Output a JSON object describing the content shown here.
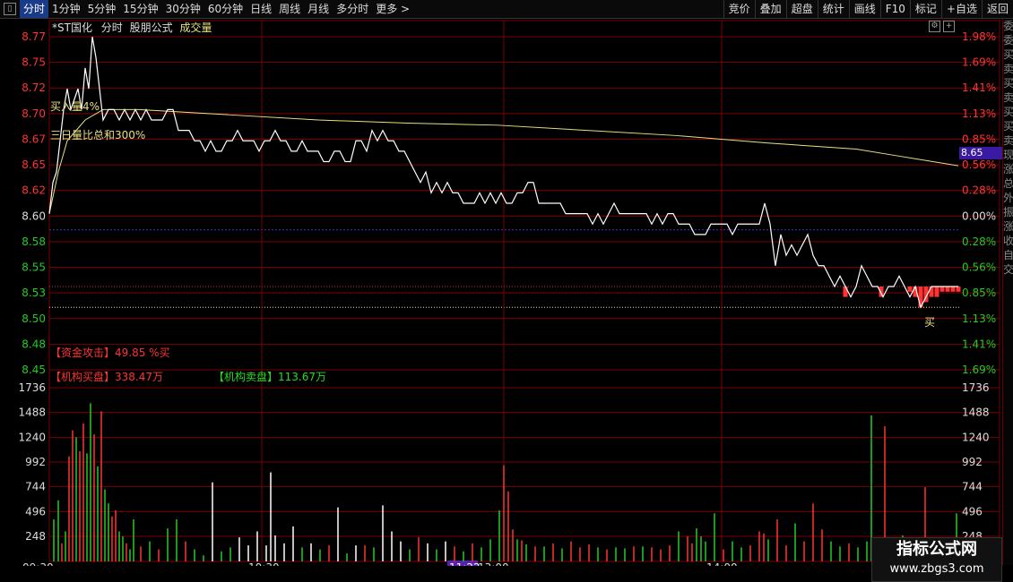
{
  "toolbar": {
    "left_items": [
      "分时",
      "1分钟",
      "5分钟",
      "15分钟",
      "30分钟",
      "60分钟",
      "日线",
      "周线",
      "月线",
      "多分时",
      "更多 >"
    ],
    "right_items": [
      "竞价",
      "叠加",
      "超盘",
      "统计",
      "画线",
      "F10",
      "标记",
      "+自选",
      "返回"
    ]
  },
  "title": {
    "stock": "*ST国化",
    "mode": "分时",
    "formula": "股朋公式",
    "indicator": "成交量"
  },
  "annotations": {
    "buy_vol": "买入量4%",
    "three_day": "三日量比总和300%",
    "fund_attack": "【资金攻击】49.85 %买",
    "inst_buy": "【机构买盘】338.47万",
    "inst_sell": "【机构卖盘】113.67万",
    "buy_mark": "买",
    "current_price_tag": "8.65"
  },
  "watermark": {
    "title": "指标公式网",
    "url": "www.zbgs3.com"
  },
  "right_col_text": [
    "委",
    "委",
    "买",
    "卖",
    "买",
    "卖",
    "买",
    "买",
    "卖",
    "现",
    "涨",
    "总",
    "外",
    "振",
    "涨",
    "收",
    "自",
    "交"
  ],
  "colors": {
    "up": "#ff3333",
    "down": "#22cc22",
    "avg": "#e8e080",
    "grid": "#7a0000",
    "price": "#ffffff",
    "title_accent": "#e8e080"
  },
  "chart_data": {
    "type": "line",
    "price_axis_left": [
      "8.77",
      "8.75",
      "8.72",
      "8.70",
      "8.67",
      "8.65",
      "8.62",
      "8.60",
      "8.58",
      "8.55",
      "8.53",
      "8.50",
      "8.48",
      "8.45"
    ],
    "price_axis_right": [
      "1.98%",
      "1.69%",
      "1.41%",
      "1.13%",
      "0.85%",
      "0.56%",
      "0.28%",
      "0.00%",
      "0.28%",
      "0.56%",
      "0.85%",
      "1.13%",
      "1.41%",
      "1.69%"
    ],
    "vol_axis": [
      "1736",
      "1488",
      "1240",
      "992",
      "744",
      "496",
      "248"
    ],
    "x_ticks": [
      "09:30",
      "10:30",
      "11:22",
      "13:00",
      "14:00"
    ],
    "ylim_price": [
      8.45,
      8.77
    ],
    "prev_close": 8.6,
    "price_points": [
      [
        0,
        8.6
      ],
      [
        4,
        8.63
      ],
      [
        8,
        8.64
      ],
      [
        12,
        8.67
      ],
      [
        16,
        8.7
      ],
      [
        20,
        8.72
      ],
      [
        24,
        8.7
      ],
      [
        28,
        8.71
      ],
      [
        32,
        8.72
      ],
      [
        36,
        8.7
      ],
      [
        40,
        8.74
      ],
      [
        44,
        8.72
      ],
      [
        48,
        8.77
      ],
      [
        52,
        8.75
      ],
      [
        56,
        8.72
      ],
      [
        60,
        8.69
      ],
      [
        66,
        8.7
      ],
      [
        72,
        8.7
      ],
      [
        78,
        8.69
      ],
      [
        84,
        8.7
      ],
      [
        90,
        8.69
      ],
      [
        96,
        8.7
      ],
      [
        102,
        8.69
      ],
      [
        108,
        8.7
      ],
      [
        114,
        8.69
      ],
      [
        120,
        8.69
      ],
      [
        126,
        8.69
      ],
      [
        132,
        8.7
      ],
      [
        138,
        8.7
      ],
      [
        144,
        8.68
      ],
      [
        150,
        8.68
      ],
      [
        156,
        8.68
      ],
      [
        162,
        8.67
      ],
      [
        168,
        8.67
      ],
      [
        174,
        8.66
      ],
      [
        180,
        8.67
      ],
      [
        186,
        8.66
      ],
      [
        192,
        8.66
      ],
      [
        198,
        8.67
      ],
      [
        204,
        8.67
      ],
      [
        210,
        8.68
      ],
      [
        216,
        8.67
      ],
      [
        222,
        8.67
      ],
      [
        228,
        8.67
      ],
      [
        234,
        8.66
      ],
      [
        240,
        8.67
      ],
      [
        246,
        8.67
      ],
      [
        252,
        8.68
      ],
      [
        258,
        8.67
      ],
      [
        264,
        8.67
      ],
      [
        270,
        8.66
      ],
      [
        276,
        8.66
      ],
      [
        282,
        8.67
      ],
      [
        288,
        8.66
      ],
      [
        294,
        8.66
      ],
      [
        300,
        8.66
      ],
      [
        306,
        8.65
      ],
      [
        312,
        8.65
      ],
      [
        318,
        8.66
      ],
      [
        324,
        8.66
      ],
      [
        330,
        8.65
      ],
      [
        336,
        8.65
      ],
      [
        342,
        8.67
      ],
      [
        348,
        8.67
      ],
      [
        354,
        8.66
      ],
      [
        360,
        8.68
      ],
      [
        366,
        8.67
      ],
      [
        372,
        8.68
      ],
      [
        378,
        8.67
      ],
      [
        384,
        8.67
      ],
      [
        390,
        8.66
      ],
      [
        396,
        8.66
      ],
      [
        402,
        8.65
      ],
      [
        408,
        8.64
      ],
      [
        414,
        8.63
      ],
      [
        420,
        8.64
      ],
      [
        426,
        8.62
      ],
      [
        432,
        8.63
      ],
      [
        438,
        8.62
      ],
      [
        444,
        8.63
      ],
      [
        450,
        8.62
      ],
      [
        456,
        8.62
      ],
      [
        462,
        8.61
      ],
      [
        468,
        8.61
      ],
      [
        474,
        8.61
      ],
      [
        480,
        8.62
      ],
      [
        486,
        8.61
      ],
      [
        492,
        8.62
      ],
      [
        498,
        8.61
      ],
      [
        504,
        8.62
      ],
      [
        510,
        8.61
      ],
      [
        516,
        8.61
      ],
      [
        522,
        8.62
      ],
      [
        528,
        8.62
      ],
      [
        534,
        8.63
      ],
      [
        540,
        8.63
      ],
      [
        546,
        8.61
      ],
      [
        552,
        8.61
      ],
      [
        558,
        8.61
      ],
      [
        564,
        8.61
      ],
      [
        570,
        8.61
      ],
      [
        576,
        8.6
      ],
      [
        582,
        8.6
      ],
      [
        588,
        8.6
      ],
      [
        594,
        8.6
      ],
      [
        600,
        8.6
      ],
      [
        606,
        8.59
      ],
      [
        612,
        8.6
      ],
      [
        618,
        8.59
      ],
      [
        624,
        8.6
      ],
      [
        630,
        8.61
      ],
      [
        636,
        8.6
      ],
      [
        642,
        8.6
      ],
      [
        648,
        8.6
      ],
      [
        654,
        8.6
      ],
      [
        660,
        8.6
      ],
      [
        666,
        8.6
      ],
      [
        672,
        8.59
      ],
      [
        678,
        8.6
      ],
      [
        684,
        8.59
      ],
      [
        690,
        8.6
      ],
      [
        696,
        8.6
      ],
      [
        702,
        8.59
      ],
      [
        708,
        8.59
      ],
      [
        714,
        8.59
      ],
      [
        720,
        8.58
      ],
      [
        726,
        8.58
      ],
      [
        732,
        8.58
      ],
      [
        738,
        8.59
      ],
      [
        744,
        8.59
      ],
      [
        750,
        8.59
      ],
      [
        756,
        8.59
      ],
      [
        762,
        8.58
      ],
      [
        768,
        8.59
      ],
      [
        774,
        8.59
      ],
      [
        780,
        8.59
      ],
      [
        786,
        8.59
      ],
      [
        792,
        8.59
      ],
      [
        798,
        8.61
      ],
      [
        804,
        8.59
      ],
      [
        810,
        8.55
      ],
      [
        816,
        8.58
      ],
      [
        822,
        8.56
      ],
      [
        828,
        8.57
      ],
      [
        834,
        8.56
      ],
      [
        840,
        8.57
      ],
      [
        846,
        8.58
      ],
      [
        852,
        8.56
      ],
      [
        858,
        8.55
      ],
      [
        864,
        8.55
      ],
      [
        870,
        8.54
      ],
      [
        876,
        8.53
      ],
      [
        882,
        8.54
      ],
      [
        888,
        8.53
      ],
      [
        894,
        8.52
      ],
      [
        900,
        8.53
      ],
      [
        906,
        8.55
      ],
      [
        912,
        8.54
      ],
      [
        918,
        8.53
      ],
      [
        924,
        8.53
      ],
      [
        930,
        8.52
      ],
      [
        936,
        8.53
      ],
      [
        942,
        8.53
      ],
      [
        948,
        8.54
      ],
      [
        954,
        8.53
      ],
      [
        960,
        8.52
      ],
      [
        966,
        8.53
      ],
      [
        972,
        8.51
      ],
      [
        978,
        8.52
      ],
      [
        984,
        8.53
      ],
      [
        990,
        8.53
      ],
      [
        996,
        8.53
      ],
      [
        1002,
        8.53
      ],
      [
        1008,
        8.53
      ],
      [
        1014,
        8.53
      ]
    ],
    "avg_line": [
      [
        0,
        8.6
      ],
      [
        10,
        8.64
      ],
      [
        20,
        8.67
      ],
      [
        40,
        8.69
      ],
      [
        60,
        8.7
      ],
      [
        100,
        8.7
      ],
      [
        200,
        8.695
      ],
      [
        300,
        8.69
      ],
      [
        400,
        8.687
      ],
      [
        500,
        8.685
      ],
      [
        600,
        8.68
      ],
      [
        700,
        8.675
      ],
      [
        800,
        8.668
      ],
      [
        900,
        8.662
      ],
      [
        950,
        8.655
      ],
      [
        1014,
        8.646
      ]
    ],
    "volumes": [
      [
        3,
        420,
        "d"
      ],
      [
        8,
        610,
        "d"
      ],
      [
        12,
        180,
        "u"
      ],
      [
        16,
        300,
        "d"
      ],
      [
        20,
        1050,
        "u"
      ],
      [
        24,
        1310,
        "u"
      ],
      [
        28,
        1240,
        "d"
      ],
      [
        32,
        1100,
        "u"
      ],
      [
        36,
        1380,
        "u"
      ],
      [
        40,
        1080,
        "d"
      ],
      [
        44,
        1580,
        "d"
      ],
      [
        48,
        1270,
        "u"
      ],
      [
        52,
        950,
        "d"
      ],
      [
        56,
        1500,
        "u"
      ],
      [
        60,
        720,
        "d"
      ],
      [
        64,
        580,
        "d"
      ],
      [
        68,
        450,
        "u"
      ],
      [
        72,
        510,
        "u"
      ],
      [
        76,
        300,
        "d"
      ],
      [
        80,
        250,
        "d"
      ],
      [
        84,
        180,
        "u"
      ],
      [
        88,
        120,
        "d"
      ],
      [
        92,
        420,
        "d"
      ],
      [
        100,
        150,
        "u"
      ],
      [
        110,
        200,
        "d"
      ],
      [
        120,
        120,
        "u"
      ],
      [
        130,
        330,
        "d"
      ],
      [
        140,
        420,
        "d"
      ],
      [
        150,
        200,
        "u"
      ],
      [
        160,
        120,
        "d"
      ],
      [
        170,
        60,
        "d"
      ],
      [
        180,
        790,
        "d"
      ],
      [
        190,
        100,
        "d"
      ],
      [
        200,
        140,
        "d"
      ],
      [
        210,
        240,
        "d"
      ],
      [
        220,
        160,
        "d"
      ],
      [
        230,
        300,
        "d"
      ],
      [
        240,
        160,
        "d"
      ],
      [
        245,
        890,
        "d"
      ],
      [
        250,
        260,
        "d"
      ],
      [
        260,
        180,
        "d"
      ],
      [
        270,
        350,
        "d"
      ],
      [
        280,
        140,
        "d"
      ],
      [
        290,
        180,
        "d"
      ],
      [
        300,
        120,
        "d"
      ],
      [
        310,
        160,
        "u"
      ],
      [
        320,
        540,
        "d"
      ],
      [
        330,
        80,
        "d"
      ],
      [
        340,
        160,
        "d"
      ],
      [
        350,
        160,
        "u"
      ],
      [
        360,
        140,
        "d"
      ],
      [
        370,
        560,
        "d"
      ],
      [
        380,
        300,
        "d"
      ],
      [
        390,
        200,
        "d"
      ],
      [
        400,
        120,
        "d"
      ],
      [
        410,
        240,
        "u"
      ],
      [
        420,
        180,
        "d"
      ],
      [
        430,
        120,
        "d"
      ],
      [
        440,
        200,
        "d"
      ],
      [
        450,
        150,
        "u"
      ],
      [
        460,
        100,
        "d"
      ],
      [
        470,
        180,
        "u"
      ],
      [
        480,
        140,
        "d"
      ],
      [
        490,
        220,
        "d"
      ],
      [
        500,
        510,
        "d"
      ],
      [
        505,
        960,
        "u"
      ],
      [
        510,
        700,
        "u"
      ],
      [
        515,
        320,
        "u"
      ],
      [
        520,
        220,
        "d"
      ],
      [
        525,
        210,
        "u"
      ],
      [
        530,
        170,
        "d"
      ],
      [
        540,
        150,
        "u"
      ],
      [
        550,
        150,
        "d"
      ],
      [
        560,
        180,
        "u"
      ],
      [
        570,
        130,
        "d"
      ],
      [
        580,
        200,
        "u"
      ],
      [
        590,
        140,
        "u"
      ],
      [
        600,
        170,
        "u"
      ],
      [
        610,
        140,
        "d"
      ],
      [
        620,
        120,
        "u"
      ],
      [
        630,
        140,
        "d"
      ],
      [
        640,
        130,
        "d"
      ],
      [
        650,
        150,
        "u"
      ],
      [
        660,
        150,
        "d"
      ],
      [
        670,
        140,
        "u"
      ],
      [
        680,
        120,
        "u"
      ],
      [
        690,
        160,
        "u"
      ],
      [
        700,
        300,
        "d"
      ],
      [
        710,
        250,
        "u"
      ],
      [
        715,
        180,
        "u"
      ],
      [
        720,
        330,
        "d"
      ],
      [
        725,
        250,
        "d"
      ],
      [
        730,
        200,
        "d"
      ],
      [
        740,
        480,
        "d"
      ],
      [
        750,
        120,
        "u"
      ],
      [
        760,
        200,
        "d"
      ],
      [
        770,
        140,
        "d"
      ],
      [
        780,
        160,
        "u"
      ],
      [
        790,
        300,
        "u"
      ],
      [
        795,
        280,
        "u"
      ],
      [
        800,
        220,
        "d"
      ],
      [
        810,
        420,
        "u"
      ],
      [
        820,
        160,
        "u"
      ],
      [
        830,
        380,
        "d"
      ],
      [
        840,
        200,
        "u"
      ],
      [
        850,
        580,
        "u"
      ],
      [
        860,
        320,
        "u"
      ],
      [
        870,
        200,
        "d"
      ],
      [
        880,
        150,
        "d"
      ],
      [
        890,
        180,
        "u"
      ],
      [
        900,
        140,
        "d"
      ],
      [
        910,
        200,
        "d"
      ],
      [
        915,
        1460,
        "d"
      ],
      [
        920,
        240,
        "d"
      ],
      [
        930,
        1350,
        "u"
      ],
      [
        940,
        120,
        "d"
      ],
      [
        950,
        260,
        "d"
      ],
      [
        960,
        160,
        "d"
      ],
      [
        970,
        200,
        "d"
      ],
      [
        975,
        740,
        "u"
      ],
      [
        980,
        200,
        "u"
      ],
      [
        990,
        120,
        "d"
      ],
      [
        1000,
        200,
        "u"
      ],
      [
        1010,
        480,
        "d"
      ]
    ],
    "vol_max": 1736,
    "red_bars": [
      [
        888,
        8.52
      ],
      [
        928,
        8.52
      ],
      [
        960,
        8.525
      ],
      [
        966,
        8.52
      ],
      [
        972,
        8.51
      ],
      [
        978,
        8.515
      ],
      [
        984,
        8.52
      ],
      [
        990,
        8.52
      ],
      [
        996,
        8.525
      ],
      [
        1002,
        8.525
      ],
      [
        1008,
        8.525
      ],
      [
        1014,
        8.525
      ]
    ]
  }
}
